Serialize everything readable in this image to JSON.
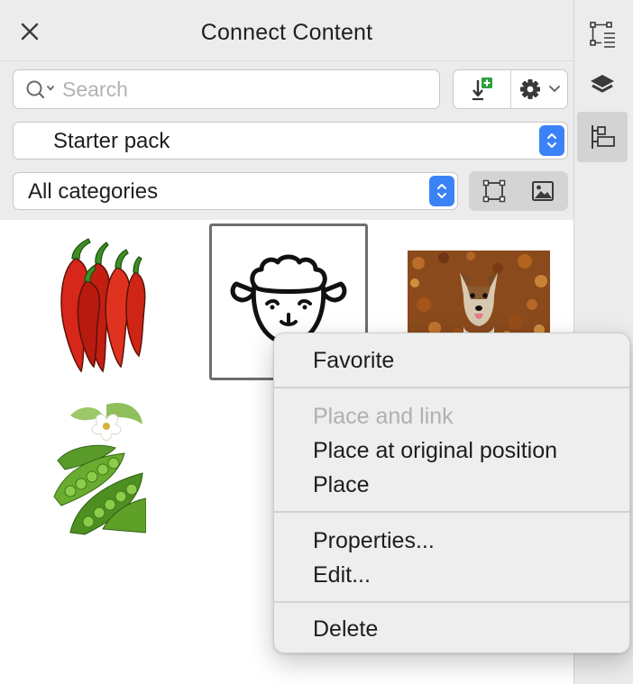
{
  "panel": {
    "title": "Connect Content",
    "search": {
      "value": "",
      "placeholder": "Search"
    },
    "toolbar": {
      "import_icon": "import-add-icon",
      "settings_icon": "gear-icon"
    },
    "pack_select": {
      "selected": "Starter pack"
    },
    "category_select": {
      "selected": "All categories"
    },
    "view_toggle": {
      "options": [
        "frame-view",
        "image-view"
      ]
    }
  },
  "thumbnails": [
    {
      "name": "red chili peppers"
    },
    {
      "name": "sheep face outline",
      "selected": true
    },
    {
      "name": "dog in autumn leaves"
    },
    {
      "name": "green pea pods"
    }
  ],
  "dock": {
    "items": [
      "transform-icon",
      "layers-icon",
      "connect-content-icon"
    ],
    "active": "connect-content-icon"
  },
  "context_menu": {
    "groups": [
      [
        {
          "label": "Favorite",
          "enabled": true
        }
      ],
      [
        {
          "label": "Place and link",
          "enabled": false
        },
        {
          "label": "Place at original position",
          "enabled": true
        },
        {
          "label": "Place",
          "enabled": true
        }
      ],
      [
        {
          "label": "Properties...",
          "enabled": true
        },
        {
          "label": "Edit...",
          "enabled": true
        }
      ],
      [
        {
          "label": "Delete",
          "enabled": true
        }
      ]
    ]
  },
  "colors": {
    "accent": "#3b82f6",
    "panel_bg": "#ececec",
    "menu_bg": "#eeeeee",
    "disabled_text": "#b0b0b0"
  }
}
